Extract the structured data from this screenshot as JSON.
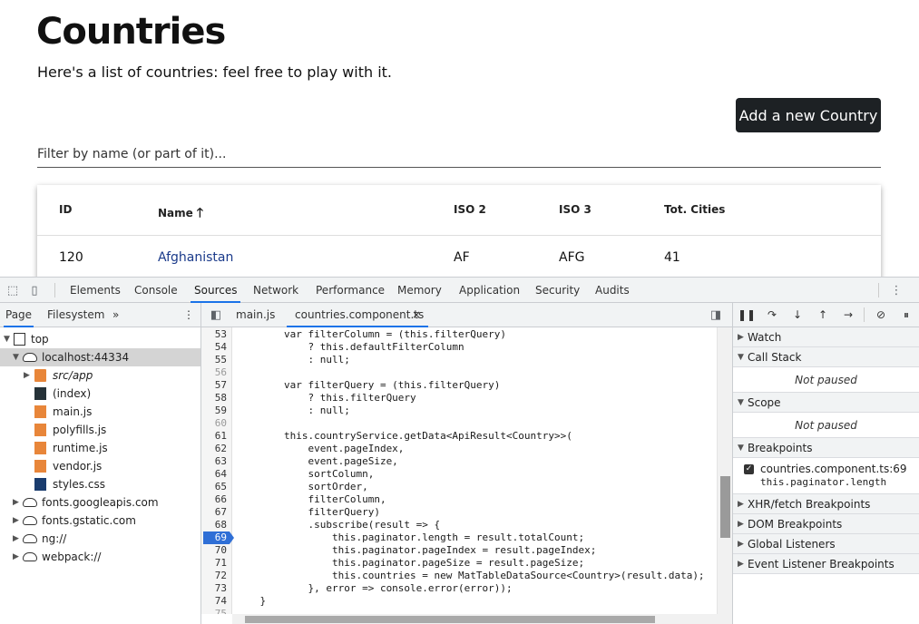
{
  "app": {
    "title": "Countries",
    "subtitle": "Here's a list of countries: feel free to play with it.",
    "add_button": "Add a new Country",
    "filter_placeholder": "Filter by name (or part of it)...",
    "table": {
      "headers": [
        "ID",
        "Name",
        "ISO 2",
        "ISO 3",
        "Tot. Cities"
      ],
      "rows": [
        [
          "120",
          "Afghanistan",
          "AF",
          "AFG",
          "41"
        ]
      ]
    }
  },
  "devtools": {
    "tabs": [
      "Elements",
      "Console",
      "Sources",
      "Network",
      "Performance",
      "Memory",
      "Application",
      "Security",
      "Audits"
    ],
    "active_tab": "Sources",
    "navigator": {
      "tabs": [
        "Page",
        "Filesystem"
      ],
      "more": "»",
      "tree": [
        {
          "label": "top"
        },
        {
          "label": "localhost:44334"
        },
        {
          "label": "src/app"
        },
        {
          "label": "(index)"
        },
        {
          "label": "main.js"
        },
        {
          "label": "polyfills.js"
        },
        {
          "label": "runtime.js"
        },
        {
          "label": "vendor.js"
        },
        {
          "label": "styles.css"
        },
        {
          "label": "fonts.googleapis.com"
        },
        {
          "label": "fonts.gstatic.com"
        },
        {
          "label": "ng://"
        },
        {
          "label": "webpack://"
        }
      ]
    },
    "editor": {
      "tabs": [
        "main.js",
        "countries.component.ts"
      ],
      "close_glyph": "×",
      "lines": [
        {
          "n": "53",
          "code": "        var filterColumn = (this.filterQuery)"
        },
        {
          "n": "54",
          "code": "            ? this.defaultFilterColumn"
        },
        {
          "n": "55",
          "code": "            : null;"
        },
        {
          "n": "56",
          "code": ""
        },
        {
          "n": "57",
          "code": "        var filterQuery = (this.filterQuery)"
        },
        {
          "n": "58",
          "code": "            ? this.filterQuery"
        },
        {
          "n": "59",
          "code": "            : null;"
        },
        {
          "n": "60",
          "code": ""
        },
        {
          "n": "61",
          "code": "        this.countryService.getData<ApiResult<Country>>("
        },
        {
          "n": "62",
          "code": "            event.pageIndex,"
        },
        {
          "n": "63",
          "code": "            event.pageSize,"
        },
        {
          "n": "64",
          "code": "            sortColumn,"
        },
        {
          "n": "65",
          "code": "            sortOrder,"
        },
        {
          "n": "66",
          "code": "            filterColumn,"
        },
        {
          "n": "67",
          "code": "            filterQuery)"
        },
        {
          "n": "68",
          "code": "            .subscribe(result => {"
        },
        {
          "n": "69",
          "code": "                this.paginator.length = result.totalCount;"
        },
        {
          "n": "70",
          "code": "                this.paginator.pageIndex = result.pageIndex;"
        },
        {
          "n": "71",
          "code": "                this.paginator.pageSize = result.pageSize;"
        },
        {
          "n": "72",
          "code": "                this.countries = new MatTableDataSource<Country>(result.data);"
        },
        {
          "n": "73",
          "code": "            }, error => console.error(error));"
        },
        {
          "n": "74",
          "code": "    }"
        },
        {
          "n": "75",
          "code": ""
        }
      ],
      "breakpoint_line": "69"
    },
    "debugger": {
      "panes": {
        "watch": "Watch",
        "call_stack": "Call Stack",
        "call_stack_body": "Not paused",
        "scope": "Scope",
        "scope_body": "Not paused",
        "breakpoints": "Breakpoints",
        "breakpoint_file": "countries.component.ts:69",
        "breakpoint_code": "this.paginator.length",
        "xhr": "XHR/fetch Breakpoints",
        "dom": "DOM Breakpoints",
        "global": "Global Listeners",
        "event": "Event Listener Breakpoints"
      }
    }
  },
  "colors": {
    "accent": "#1a73e8",
    "breakpoint": "#2f6fd6",
    "button_dark": "#1d2124",
    "toolbar_bg": "#f1f3f4",
    "link": "#1a3a8a"
  }
}
